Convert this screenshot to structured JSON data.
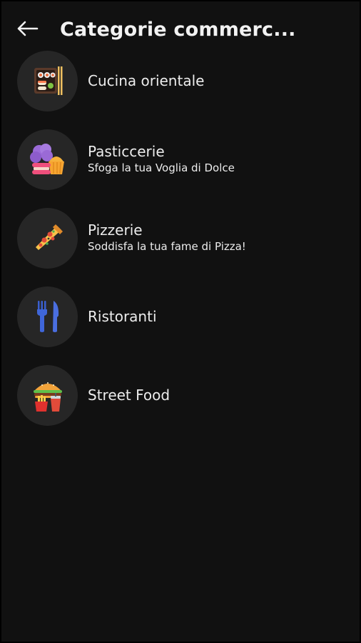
{
  "header": {
    "title": "Categorie commerc...",
    "back_icon": "arrow-left-icon"
  },
  "categories": [
    {
      "label": "Cucina orientale",
      "subtitle": "",
      "icon": "sushi-icon"
    },
    {
      "label": "Pasticcerie",
      "subtitle": "Sfoga la tua Voglia di Dolce",
      "icon": "cupcake-icon"
    },
    {
      "label": "Pizzerie",
      "subtitle": "Soddisfa la tua fame di Pizza!",
      "icon": "pizza-slice-icon"
    },
    {
      "label": "Ristoranti",
      "subtitle": "",
      "icon": "fork-knife-icon"
    },
    {
      "label": "Street Food",
      "subtitle": "",
      "icon": "burger-fries-icon"
    }
  ],
  "colors": {
    "background": "#111111",
    "avatar_bg": "#262626",
    "text": "#ececec"
  }
}
